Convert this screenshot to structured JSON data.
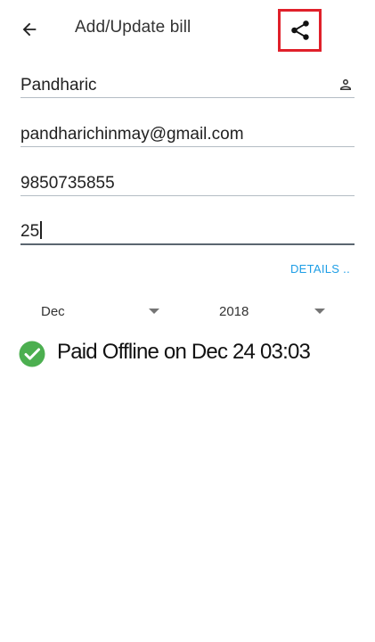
{
  "header": {
    "back_icon": "arrow-left-icon",
    "title": "Add/Update bill",
    "share_icon": "share-icon",
    "share_highlight_color": "#e0202a"
  },
  "form": {
    "name": "Pandharic",
    "name_icon": "person-icon",
    "email": "pandharichinmay@gmail.com",
    "phone": "9850735855",
    "amount": "25",
    "details_label": "DETAILS .."
  },
  "period": {
    "month": "Dec",
    "year": "2018"
  },
  "status": {
    "icon": "check-circle-icon",
    "icon_color": "#4caf50",
    "text": "Paid Offline on Dec 24 03:03"
  },
  "colors": {
    "accent_link": "#1e9ee6"
  }
}
